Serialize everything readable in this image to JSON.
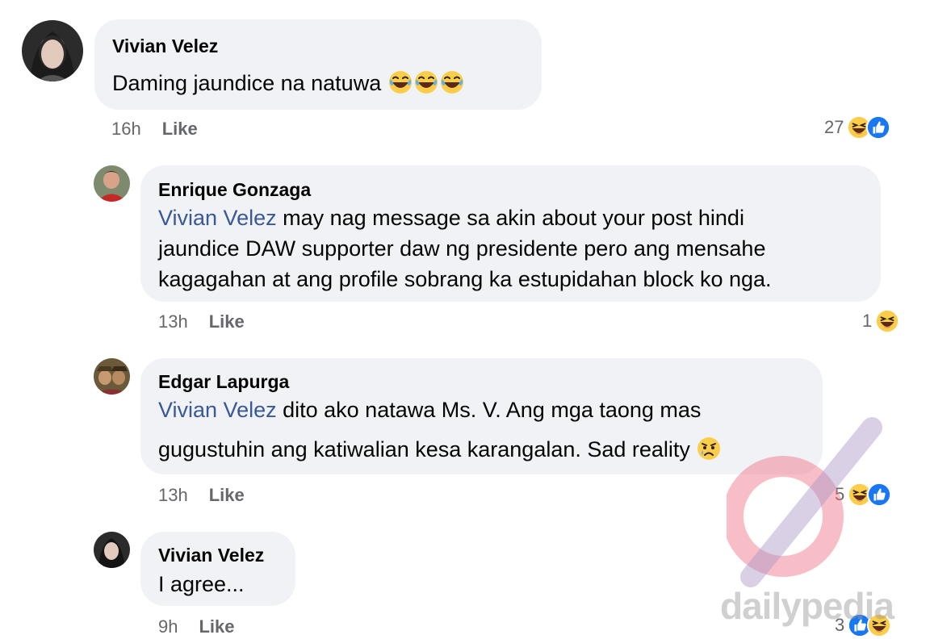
{
  "comments": [
    {
      "author": "Vivian Velez",
      "text": "Daming jaundice na natuwa",
      "time": "16h",
      "like_label": "Like",
      "reaction_count": "27",
      "reactions": [
        "haha-icon",
        "like-icon"
      ]
    },
    {
      "author": "Enrique Gonzaga",
      "mention": "Vivian Velez",
      "line1": " may nag message sa akin about your post hindi",
      "line2": "jaundice DAW supporter daw ng presidente pero ang mensahe",
      "line3": "kagagahan at ang profile sobrang ka estupidahan block ko nga.",
      "time": "13h",
      "like_label": "Like",
      "reaction_count": "1",
      "reactions": [
        "haha-icon"
      ]
    },
    {
      "author": "Edgar Lapurga",
      "mention": "Vivian Velez",
      "line1": " dito ako natawa Ms. V. Ang mga taong mas",
      "line2": "gugustuhin ang katiwalian kesa karangalan. Sad reality",
      "time": "13h",
      "like_label": "Like",
      "reaction_count": "5",
      "reactions": [
        "haha-icon",
        "like-icon"
      ]
    },
    {
      "author": "Vivian Velez",
      "text": "I agree...",
      "time": "9h",
      "like_label": "Like",
      "reaction_count": "3",
      "reactions": [
        "like-icon",
        "haha-icon"
      ]
    }
  ],
  "watermark": {
    "text": "dailypedia"
  },
  "colors": {
    "bubble": "#f0f2f5",
    "mention": "#385898",
    "meta": "#65676b",
    "like_blue": "#1877f2"
  }
}
